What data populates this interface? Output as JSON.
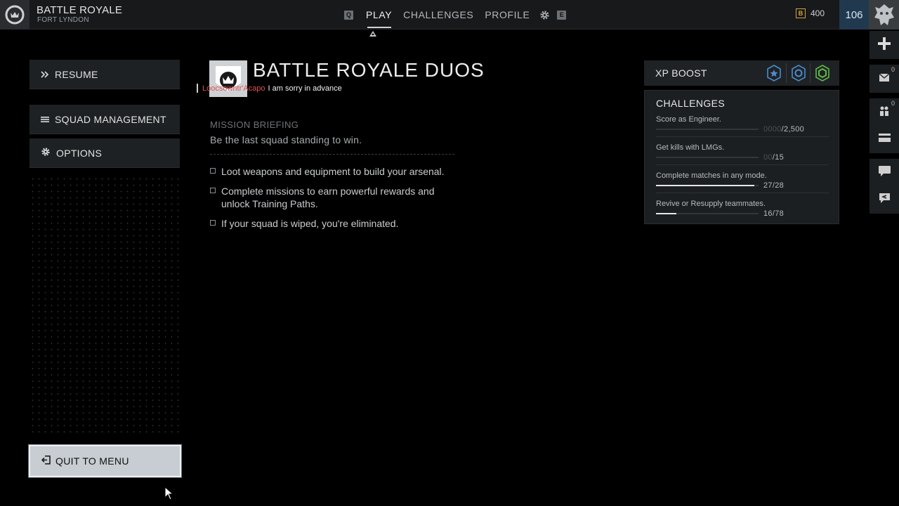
{
  "header": {
    "mode_title": "BATTLE ROYALE",
    "map_name": "FORT LYNDON",
    "nav": {
      "left_key": "Q",
      "tabs": [
        "PLAY",
        "CHALLENGES",
        "PROFILE"
      ],
      "active_tab": "PLAY",
      "right_key": "E"
    },
    "credits_icon_letter": "B",
    "credits": "400",
    "level": "106"
  },
  "left_menu": {
    "resume": "RESUME",
    "squad_management": "SQUAD MANAGEMENT",
    "options": "OPTIONS",
    "quit": "QUIT TO MENU"
  },
  "main": {
    "title": "BATTLE ROYALE DUOS",
    "chat": {
      "name": "Loocsowntr'Acapo",
      "message": "I am sorry in advance"
    },
    "briefing_heading": "MISSION BRIEFING",
    "briefing_sub": "Be the last squad standing to win.",
    "bullets": [
      "Loot weapons and equipment to build your arsenal.",
      "Complete missions to earn powerful rewards and unlock Training Paths.",
      "If your squad is wiped, you're eliminated."
    ]
  },
  "xp_boost": {
    "label": "XP BOOST",
    "icon_colors": [
      "#4a8ccf",
      "#4a8ccf",
      "#5fb84a"
    ]
  },
  "challenges": {
    "title": "CHALLENGES",
    "items": [
      {
        "name": "Score as Engineer.",
        "progress_dim": "0000",
        "progress_total": "/2,500",
        "fraction": 0.0
      },
      {
        "name": "Get kills with LMGs.",
        "progress_dim": "00",
        "progress_total": "/15",
        "fraction": 0.0
      },
      {
        "name": "Complete matches in any mode.",
        "progress_dim": "",
        "progress_total": "27/28",
        "fraction": 0.96
      },
      {
        "name": "Revive or Resupply teammates.",
        "progress_dim": "",
        "progress_total": "16/78",
        "fraction": 0.2
      }
    ]
  },
  "rail": {
    "mail_count": "0",
    "party_count": "0"
  }
}
